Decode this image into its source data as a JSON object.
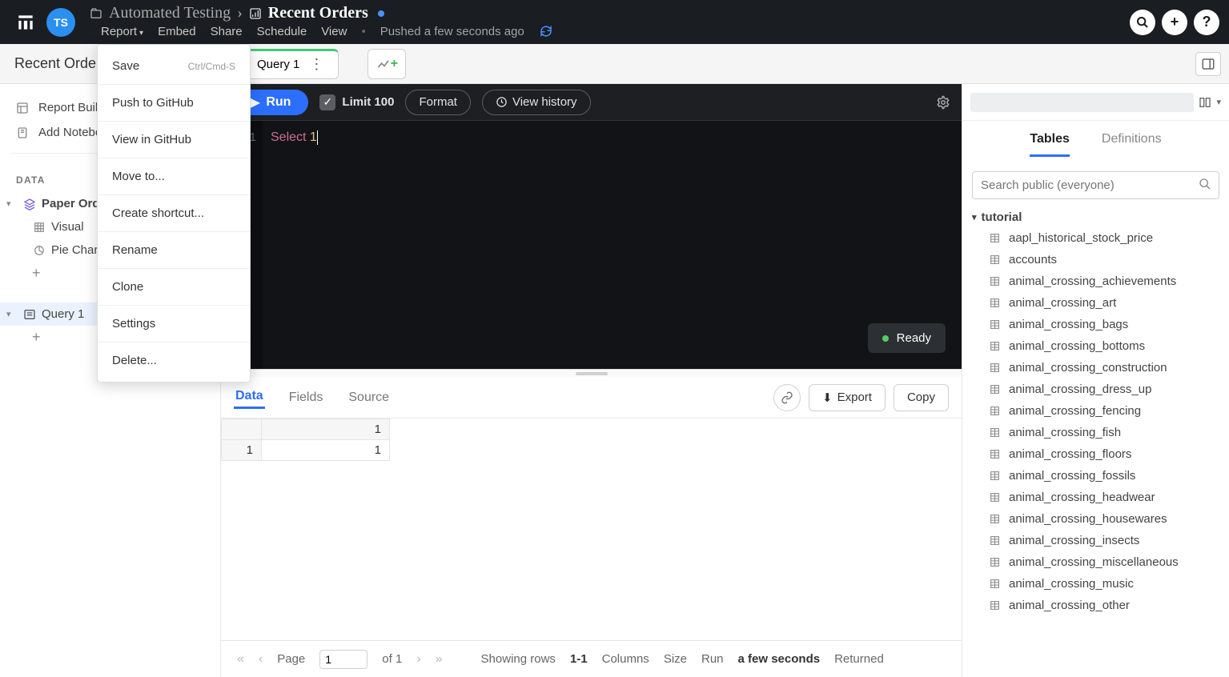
{
  "header": {
    "avatar": "TS",
    "breadcrumb_parent": "Automated Testing",
    "breadcrumb_current": "Recent Orders",
    "menus": [
      "Report",
      "Embed",
      "Share",
      "Schedule",
      "View"
    ],
    "pushed": "Pushed a few seconds ago"
  },
  "dropdown": {
    "save": "Save",
    "save_hint": "Ctrl/Cmd-S",
    "push": "Push to GitHub",
    "view_gh": "View in GitHub",
    "move": "Move to...",
    "shortcut": "Create shortcut...",
    "rename": "Rename",
    "clone": "Clone",
    "settings": "Settings",
    "delete": "Delete..."
  },
  "tabbar": {
    "left_title": "Recent Orders",
    "tab1": "Query 1"
  },
  "sidebar": {
    "report_builder": "Report Builder",
    "add_notebook": "Add Notebook Cell",
    "data_label": "DATA",
    "paper_orders": "Paper Orders",
    "visual": "Visual",
    "pie_chart": "Pie Chart",
    "query1": "Query 1"
  },
  "toolbar": {
    "run": "Run",
    "limit": "Limit 100",
    "format": "Format",
    "history": "View history"
  },
  "code": {
    "line1_kw": "Select",
    "line1_num": "1",
    "lineno": "1"
  },
  "ready": "Ready",
  "results": {
    "tabs": [
      "Data",
      "Fields",
      "Source"
    ],
    "export": "Export",
    "copy": "Copy",
    "header_col": "1",
    "row_idx": "1",
    "cell_val": "1"
  },
  "footer": {
    "page_label": "Page",
    "page_val": "1",
    "of": "of 1",
    "showing": "Showing rows",
    "range": "1-1",
    "columns": "Columns",
    "size": "Size",
    "run": "Run",
    "runtime": "a few seconds",
    "returned": "Returned"
  },
  "right": {
    "tabs": [
      "Tables",
      "Definitions"
    ],
    "search_ph": "Search public (everyone)",
    "db": "tutorial",
    "tables": [
      "aapl_historical_stock_price",
      "accounts",
      "animal_crossing_achievements",
      "animal_crossing_art",
      "animal_crossing_bags",
      "animal_crossing_bottoms",
      "animal_crossing_construction",
      "animal_crossing_dress_up",
      "animal_crossing_fencing",
      "animal_crossing_fish",
      "animal_crossing_floors",
      "animal_crossing_fossils",
      "animal_crossing_headwear",
      "animal_crossing_housewares",
      "animal_crossing_insects",
      "animal_crossing_miscellaneous",
      "animal_crossing_music",
      "animal_crossing_other"
    ]
  }
}
